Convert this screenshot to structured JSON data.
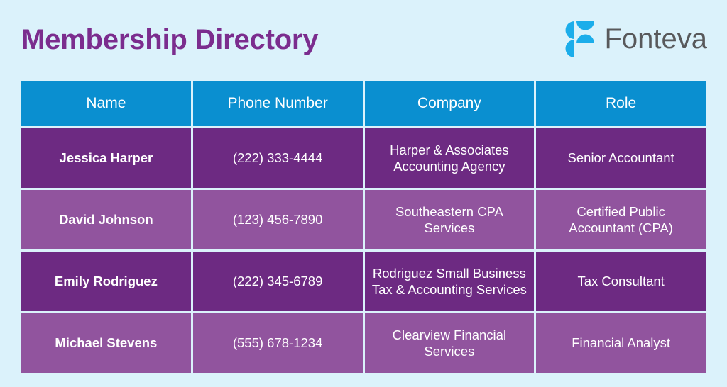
{
  "header": {
    "title": "Membership Directory",
    "logo": {
      "name": "Fonteva",
      "mark_icon": "fonteva-f-mark-icon",
      "mark_color": "#1badea",
      "text_color": "#58595b"
    }
  },
  "theme": {
    "background": "#dbf2fb",
    "title_color": "#7b2d8e",
    "header_row_color": "#0a8fd0",
    "row_dark_color": "#6d2a82",
    "row_light_color": "#91549e",
    "text_color": "#ffffff"
  },
  "table": {
    "columns": [
      "Name",
      "Phone Number",
      "Company",
      "Role"
    ],
    "rows": [
      {
        "name": "Jessica Harper",
        "phone": "(222) 333-4444",
        "company": "Harper & Associates Accounting Agency",
        "role": "Senior Accountant"
      },
      {
        "name": "David Johnson",
        "phone": "(123) 456-7890",
        "company": "Southeastern CPA Services",
        "role": "Certified Public Accountant (CPA)"
      },
      {
        "name": "Emily Rodriguez",
        "phone": "(222) 345-6789",
        "company": "Rodriguez Small Business Tax & Accounting Services",
        "role": "Tax Consultant"
      },
      {
        "name": "Michael Stevens",
        "phone": "(555) 678-1234",
        "company": "Clearview Financial Services",
        "role": "Financial Analyst"
      }
    ]
  }
}
